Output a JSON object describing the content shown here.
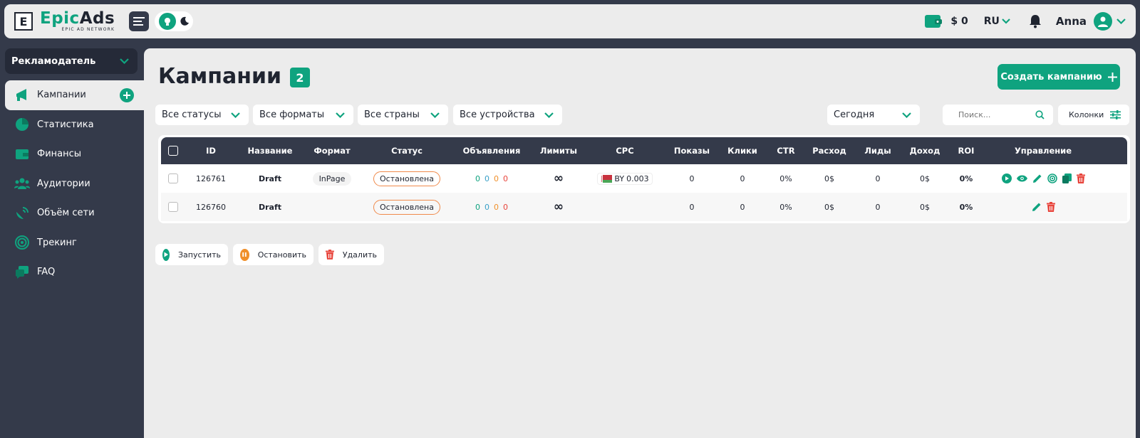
{
  "header": {
    "logo_letter": "E",
    "logo_epic": "Epic",
    "logo_ads": "Ads",
    "logo_sub": "EPIC AD NETWORK",
    "balance": "$ 0",
    "language": "RU",
    "user_name": "Anna"
  },
  "sidebar": {
    "role": "Рекламодатель",
    "items": [
      {
        "label": "Кампании",
        "icon": "megaphone-icon",
        "active": true
      },
      {
        "label": "Статистика",
        "icon": "pie-chart-icon"
      },
      {
        "label": "Финансы",
        "icon": "wallet-icon"
      },
      {
        "label": "Аудитории",
        "icon": "users-icon"
      },
      {
        "label": "Объём сети",
        "icon": "satellite-icon"
      },
      {
        "label": "Трекинг",
        "icon": "target-icon"
      },
      {
        "label": "FAQ",
        "icon": "chat-icon"
      }
    ]
  },
  "main": {
    "title": "Кампании",
    "count": "2",
    "create_label": "Создать кампанию",
    "filters": {
      "status": "Все статусы",
      "formats": "Все форматы",
      "countries": "Все страны",
      "devices": "Все устройства",
      "period": "Сегодня",
      "search_placeholder": "Поиск...",
      "columns": "Колонки"
    },
    "table": {
      "headers": [
        "ID",
        "Название",
        "Формат",
        "Статус",
        "Объявления",
        "Лимиты",
        "CPC",
        "Показы",
        "Клики",
        "CTR",
        "Расход",
        "Лиды",
        "Доход",
        "ROI",
        "Управление"
      ],
      "rows": [
        {
          "id": "126761",
          "name": "Draft",
          "format": "InPage",
          "status": "Остановлена",
          "ads": [
            "0",
            "0",
            "0",
            "0"
          ],
          "limits": "∞",
          "cpc_country": "BY",
          "cpc_value": "0.003",
          "impressions": "0",
          "clicks": "0",
          "ctr": "0%",
          "spend": "0$",
          "leads": "0",
          "income": "0$",
          "roi": "0%"
        },
        {
          "id": "126760",
          "name": "Draft",
          "format": "",
          "status": "Остановлена",
          "ads": [
            "0",
            "0",
            "0",
            "0"
          ],
          "limits": "∞",
          "cpc_country": "",
          "cpc_value": "",
          "impressions": "0",
          "clicks": "0",
          "ctr": "0%",
          "spend": "0$",
          "leads": "0",
          "income": "0$",
          "roi": "0%"
        }
      ]
    },
    "bulk": {
      "start": "Запустить",
      "stop": "Остановить",
      "delete": "Удалить"
    }
  },
  "colors": {
    "accent": "#0fa37f",
    "dark": "#343a4a",
    "stopped": "#f08a4b",
    "danger": "#e8453c"
  }
}
